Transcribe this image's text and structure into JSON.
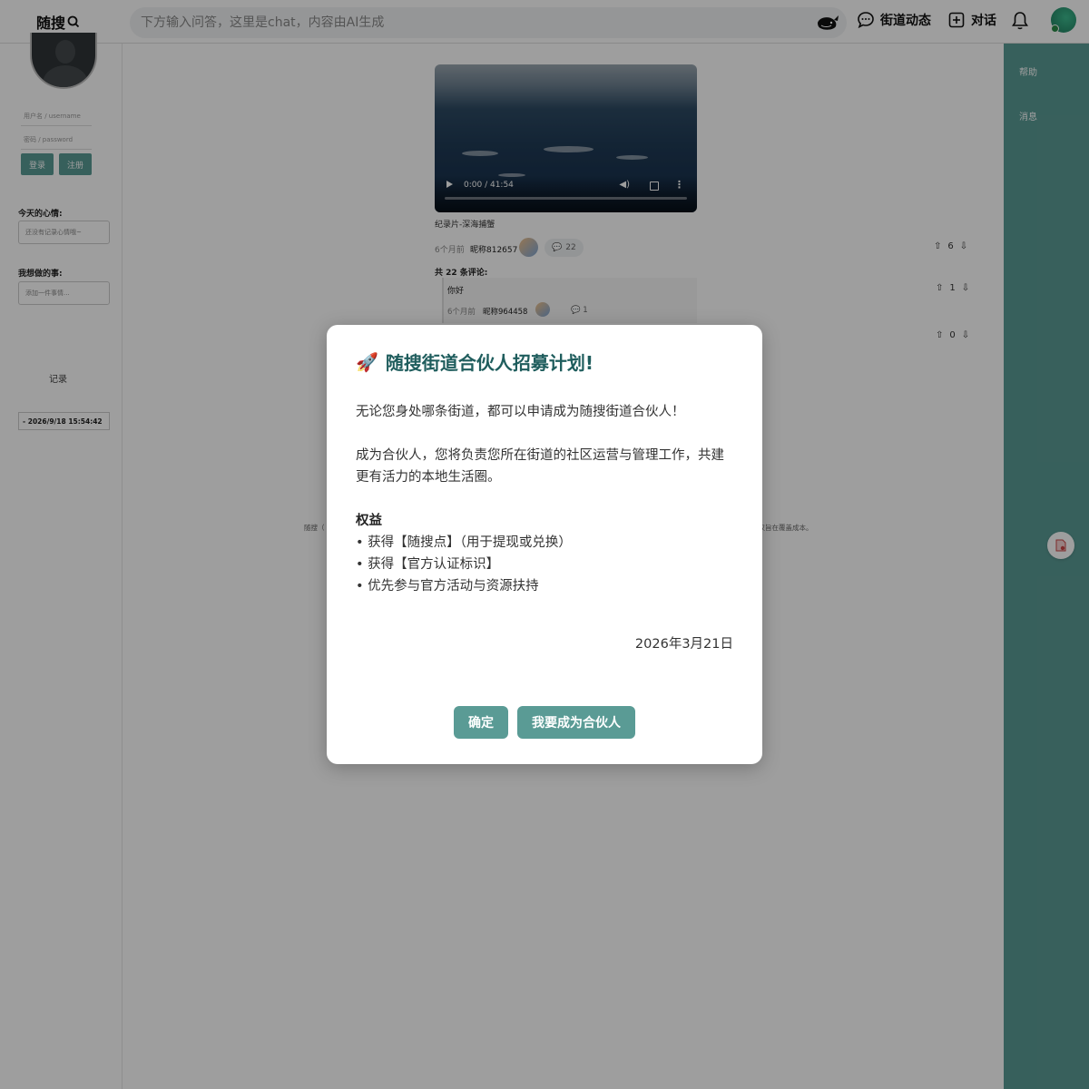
{
  "header": {
    "logo_text": "随搜",
    "search_placeholder": "下方输入问答，这里是chat，内容由AI生成",
    "nav_street": "街道动态",
    "nav_chat": "对话"
  },
  "sidebar_left": {
    "username_placeholder": "用户名 / username",
    "password_placeholder": "密码 / password",
    "login_label": "登录",
    "register_label": "注册",
    "mood_label": "今天的心情:",
    "mood_placeholder": "还没有记录心情哦~",
    "todo_label": "我想做的事:",
    "todo_placeholder": "添加一件事情...",
    "record_label": "记录",
    "record_time": "- 2026/9/18 15:54:42"
  },
  "post": {
    "video_time": "0:00 / 41:54",
    "title": "纪录片-深海捕蟹",
    "ago": "6个月前",
    "author": "昵称812657",
    "comment_count": "22",
    "upvotes": "6",
    "comments_heading": "共 22 条评论:",
    "comments": [
      {
        "text": "你好",
        "ago": "6个月前",
        "author": "昵称964458",
        "replies": "1",
        "votes": "1"
      }
    ],
    "extra_votes": "0"
  },
  "footer": {
    "left_fragment": "随搜（",
    "right_fragment": "用仅旨在覆盖成本。"
  },
  "sidebar_right": {
    "help": "帮助",
    "messages": "消息"
  },
  "modal": {
    "title": "随搜街道合伙人招募计划!",
    "icon": "rocket-icon",
    "p1": "无论您身处哪条街道，都可以申请成为随搜街道合伙人！",
    "p2": "成为合伙人，您将负责您所在街道的社区运营与管理工作，共建更有活力的本地生活圈。",
    "benefits_heading": "权益",
    "benefits": [
      "• 获得【随搜点】（用于提现或兑换）",
      "• 获得【官方认证标识】",
      "• 优先参与官方活动与资源扶持"
    ],
    "date": "2026年3月21日",
    "confirm_label": "确定",
    "join_label": "我要成为合伙人"
  },
  "colors": {
    "accent": "#5a9b95",
    "title": "#1f5d5d"
  }
}
